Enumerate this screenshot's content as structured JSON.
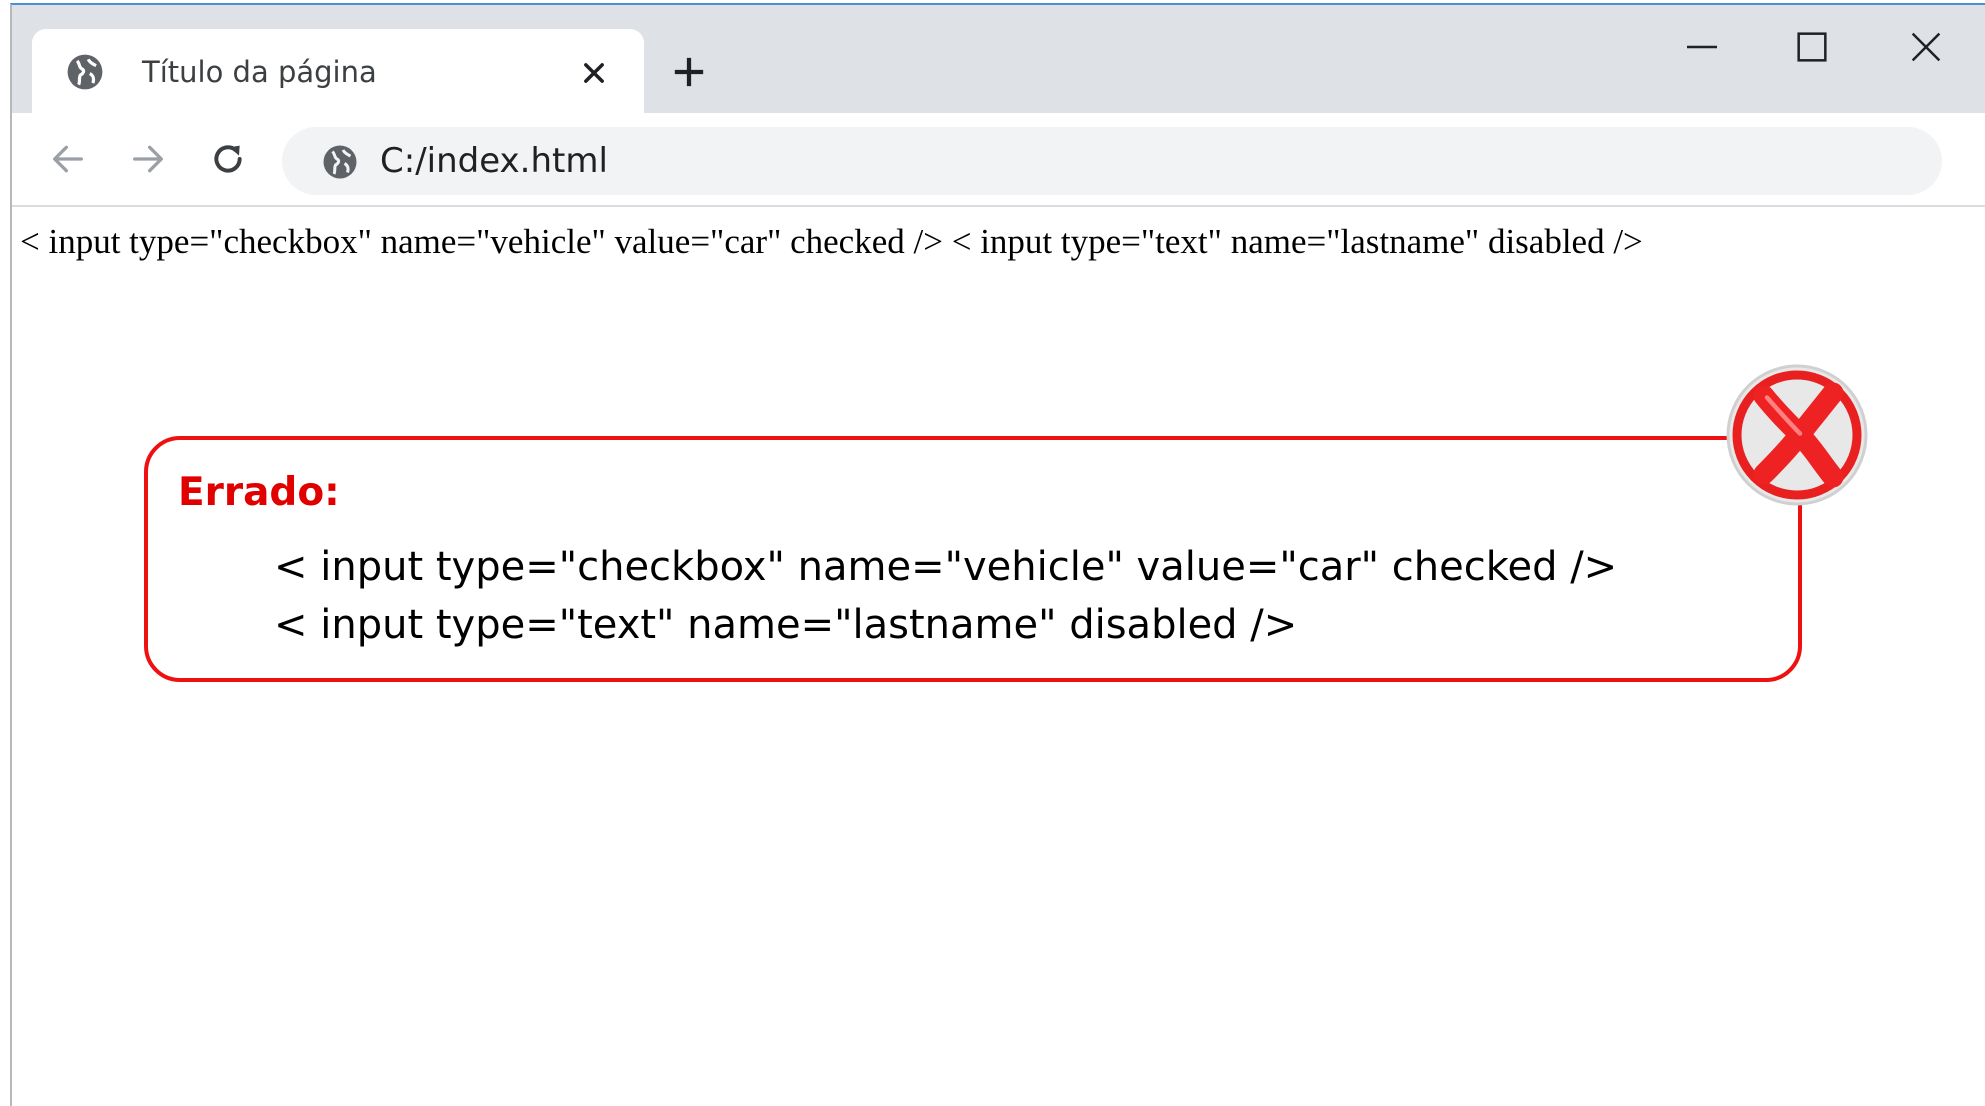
{
  "browser": {
    "tab": {
      "title": "Título da página",
      "favicon": "globe-icon"
    },
    "new_tab_icon": "plus-icon",
    "window_controls": [
      "minimize-icon",
      "maximize-icon",
      "close-icon"
    ],
    "nav": [
      "back-arrow-icon",
      "forward-arrow-icon",
      "reload-icon"
    ],
    "address": {
      "url": "C:/index.html",
      "site_icon": "globe-icon"
    }
  },
  "page": {
    "rendered_text": "< input type=\"checkbox\" name=\"vehicle\" value=\"car\" checked /> < input type=\"text\" name=\"lastname\" disabled />"
  },
  "callout": {
    "label": "Errado:",
    "lines": [
      "< input type=\"checkbox\" name=\"vehicle\" value=\"car\" checked />",
      "< input type=\"text\" name=\"lastname\" disabled />"
    ],
    "badge_icon": "wrong-x-icon",
    "accent_color": "#ee1111"
  }
}
